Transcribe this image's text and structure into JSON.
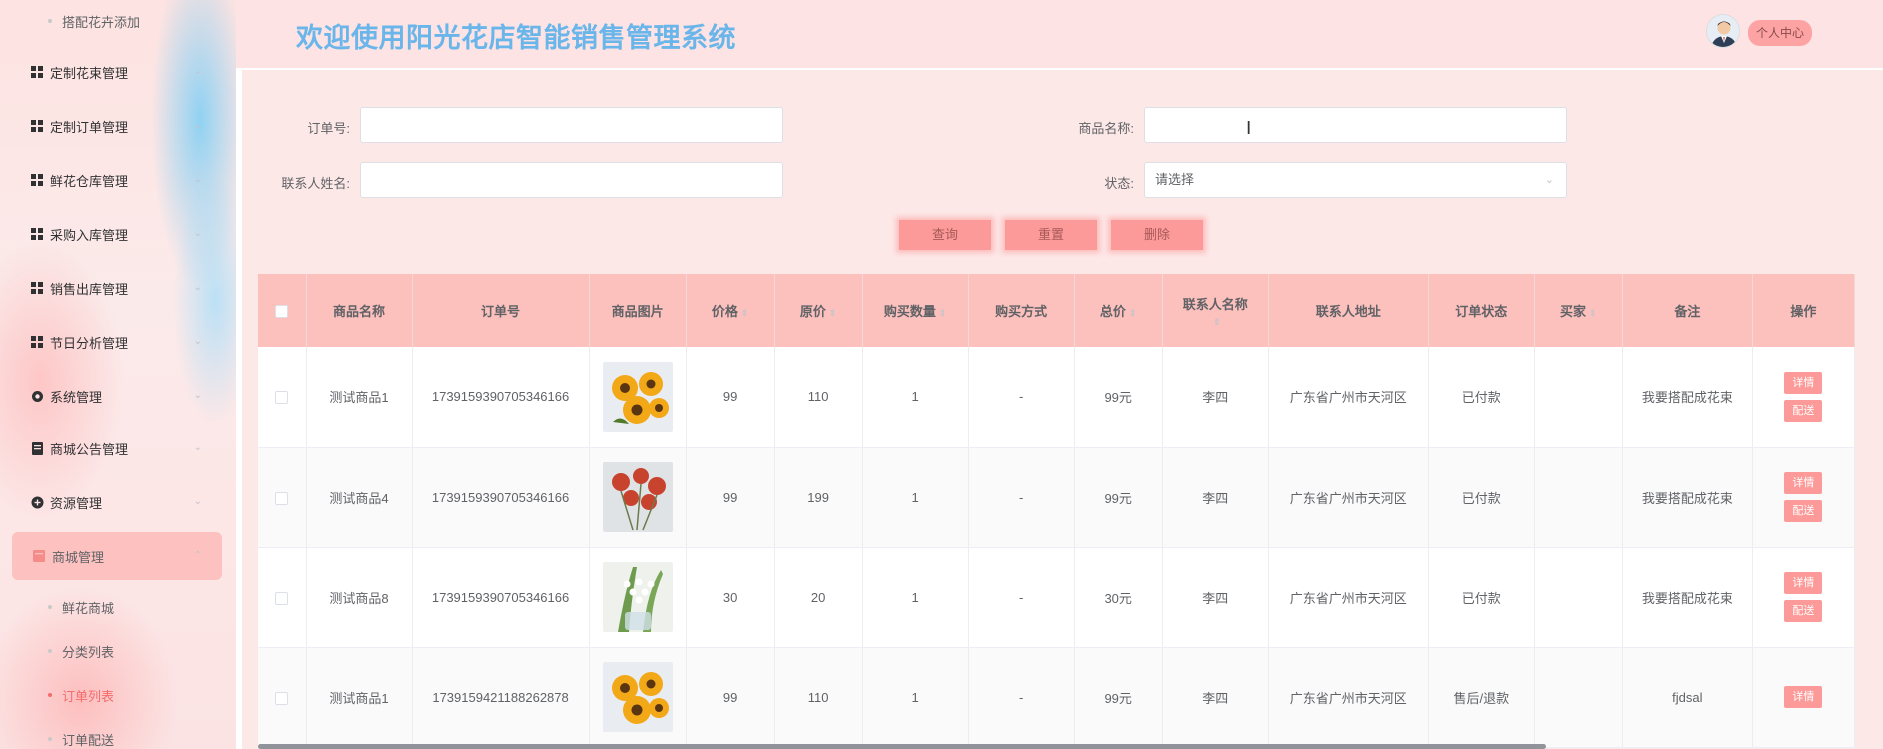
{
  "sidebar": {
    "top_sub_item": "搭配花卉添加",
    "items": [
      {
        "label": "定制花束管理"
      },
      {
        "label": "定制订单管理"
      },
      {
        "label": "鲜花仓库管理"
      },
      {
        "label": "采购入库管理"
      },
      {
        "label": "销售出库管理"
      },
      {
        "label": "节日分析管理"
      },
      {
        "label": "系统管理"
      },
      {
        "label": "商城公告管理"
      },
      {
        "label": "资源管理"
      }
    ],
    "open_menu": {
      "label": "商城管理"
    },
    "sub_items": [
      {
        "label": "鲜花商城"
      },
      {
        "label": "分类列表"
      },
      {
        "label": "订单列表"
      },
      {
        "label": "订单配送"
      }
    ]
  },
  "header": {
    "title": "欢迎使用阳光花店智能销售管理系统",
    "profile_label": "个人中心"
  },
  "search": {
    "order_no_label": "订单号:",
    "order_no_value": "",
    "product_name_label": "商品名称:",
    "product_name_value": "",
    "contact_name_label": "联系人姓名:",
    "contact_name_value": "",
    "status_label": "状态:",
    "status_placeholder": "请选择",
    "query_btn": "查询",
    "reset_btn": "重置",
    "delete_btn": "删除"
  },
  "table": {
    "headers": {
      "product_name": "商品名称",
      "order_no": "订单号",
      "image": "商品图片",
      "price": "价格",
      "original_price": "原价",
      "quantity": "购买数量",
      "purchase_method": "购买方式",
      "total": "总价",
      "contact_name": "联系人名称",
      "address": "联系人地址",
      "status": "订单状态",
      "buyer": "买家",
      "remark": "备注",
      "actions": "操作"
    },
    "rows": [
      {
        "product_name": "测试商品1",
        "order_no": "1739159390705346166",
        "image": "sunflower",
        "price": "99",
        "original_price": "110",
        "quantity": "1",
        "purchase_method": "-",
        "total": "99元",
        "contact_name": "李四",
        "address": "广东省广州市天河区",
        "status": "已付款",
        "buyer": "",
        "remark": "我要搭配成花束",
        "detail_btn": "详情",
        "ship_btn": "配送"
      },
      {
        "product_name": "测试商品4",
        "order_no": "1739159390705346166",
        "image": "red-roses",
        "price": "99",
        "original_price": "199",
        "quantity": "1",
        "purchase_method": "-",
        "total": "99元",
        "contact_name": "李四",
        "address": "广东省广州市天河区",
        "status": "已付款",
        "buyer": "",
        "remark": "我要搭配成花束",
        "detail_btn": "详情",
        "ship_btn": "配送"
      },
      {
        "product_name": "测试商品8",
        "order_no": "1739159390705346166",
        "image": "lily-of-valley",
        "price": "30",
        "original_price": "20",
        "quantity": "1",
        "purchase_method": "-",
        "total": "30元",
        "contact_name": "李四",
        "address": "广东省广州市天河区",
        "status": "已付款",
        "buyer": "",
        "remark": "我要搭配成花束",
        "detail_btn": "详情",
        "ship_btn": "配送"
      },
      {
        "product_name": "测试商品1",
        "order_no": "1739159421188262878",
        "image": "sunflower",
        "price": "99",
        "original_price": "110",
        "quantity": "1",
        "purchase_method": "-",
        "total": "99元",
        "contact_name": "李四",
        "address": "广东省广州市天河区",
        "status": "售后/退款",
        "buyer": "",
        "remark": "fjdsal",
        "detail_btn": "详情",
        "ship_btn": ""
      }
    ]
  },
  "colors": {
    "accent": "#fb9a98",
    "title_blue": "#6ab6ea",
    "header_bg": "#fde3e3",
    "table_header": "#fcc0bd"
  }
}
